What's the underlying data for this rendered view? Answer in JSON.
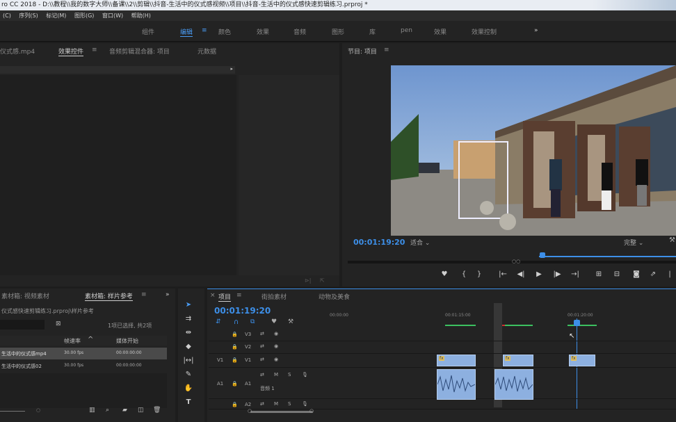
{
  "window": {
    "title": "ro CC 2018 - D:\\\\教程\\\\我的数字大师\\\\备课\\\\2\\\\剪辑\\\\抖音-生活中的仪式感视频\\\\项目\\\\抖音-生活中的仪式感快速剪辑练习.prproj *"
  },
  "menu": [
    "(C)",
    "序列(S)",
    "标记(M)",
    "图形(G)",
    "窗口(W)",
    "帮助(H)"
  ],
  "workspaces": [
    "组件",
    "编辑",
    "颜色",
    "效果",
    "音频",
    "图形",
    "库",
    "pen",
    "效果",
    "效果控制"
  ],
  "source_panel": {
    "tabs": [
      "仪式感.mp4",
      "效果控件",
      "音频剪辑混合器: 项目",
      "元数据"
    ]
  },
  "program": {
    "tab": "节目: 项目",
    "timecode": "00:01:19:20",
    "fit": "适合",
    "quality": "完整"
  },
  "project_panel": {
    "tabs": [
      "素材箱: 视频素材",
      "素材箱: 样片参考"
    ],
    "path": "仪式感快速剪辑练习.prproj\\样片参考",
    "count": "1项已选择, 共2项",
    "col_rate": "帧速率",
    "col_start": "媒体开始",
    "items": [
      {
        "name": "生活中的仪式感mp4",
        "rate": "30.00 fps",
        "start": "00:00:00:00"
      },
      {
        "name": "生活中的仪式感02",
        "rate": "30.00 fps",
        "start": "00:00:00:00"
      }
    ]
  },
  "timeline": {
    "tabs": [
      "项目",
      "街拍素材",
      "动物及美食"
    ],
    "timecode": "00:01:19:20",
    "ruler": [
      "00:00:00",
      "00:01:15:00",
      "00:01:20:00"
    ],
    "tracks": [
      "V3",
      "V2",
      "V1",
      "A1",
      "A2"
    ],
    "audio_label": "音频 1",
    "clip_labels": [
      "fx",
      "fx",
      "fx"
    ]
  },
  "colors": {
    "accent": "#3d8fe8",
    "clip": "#8db0e0",
    "green": "#3cc060",
    "red": "#d03030"
  }
}
